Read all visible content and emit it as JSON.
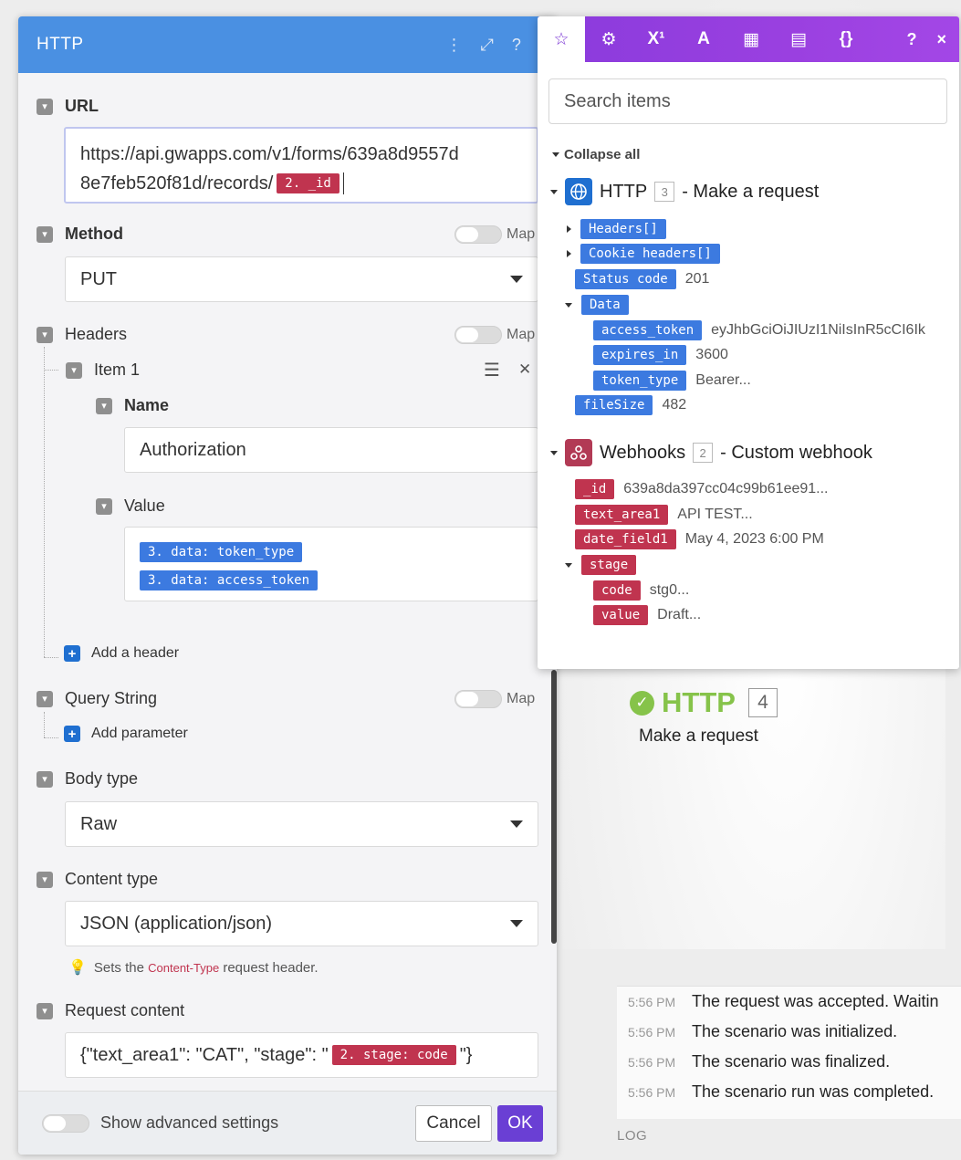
{
  "panel": {
    "title": "HTTP",
    "url_label": "URL",
    "url_text_line1": "https://api.gwapps.com/v1/forms/639a8d9557d",
    "url_text_line2": "8e7feb520f81d/records/",
    "url_pill": "2. _id",
    "method_label": "Method",
    "map_label": "Map",
    "method_value": "PUT",
    "headers_label": "Headers",
    "item_label": "Item 1",
    "name_label": "Name",
    "name_value": "Authorization",
    "value_label": "Value",
    "value_pill1": "3. data: token_type",
    "value_pill2": "3. data: access_token",
    "add_header": "Add a header",
    "query_label": "Query String",
    "add_parameter": "Add parameter",
    "body_type_label": "Body type",
    "body_type_value": "Raw",
    "content_type_label": "Content type",
    "content_type_value": "JSON (application/json)",
    "hint_prefix": "Sets the ",
    "hint_code": "Content-Type",
    "hint_suffix": " request header.",
    "request_content_label": "Request content",
    "request_prefix": "{\"text_area1\": \"CAT\", \"stage\": \"",
    "request_pill": "2. stage: code",
    "request_suffix": "\"}",
    "advanced_label": "Show advanced settings",
    "cancel_label": "Cancel",
    "ok_label": "OK"
  },
  "items_panel": {
    "tabs": [
      "☆",
      "⚙",
      "X¹",
      "A",
      "▦",
      "▤",
      "{}"
    ],
    "help": "?",
    "close": "×",
    "search_placeholder": "Search items",
    "collapse_all": "Collapse all",
    "http_module": {
      "name": "HTTP",
      "num": "3",
      "desc": "- Make a request"
    },
    "http_items": {
      "headers": "Headers[]",
      "cookie_headers": "Cookie headers[]",
      "status_code": "Status code",
      "status_code_val": "201",
      "data": "Data",
      "access_token": "access_token",
      "access_token_val": "eyJhbGciOiJIUzI1NiIsInR5cCI6Ik",
      "expires_in": "expires_in",
      "expires_in_val": "3600",
      "token_type": "token_type",
      "token_type_val": "Bearer...",
      "file_size": "fileSize",
      "file_size_val": "482"
    },
    "webhook_module": {
      "name": "Webhooks",
      "num": "2",
      "desc": "- Custom webhook"
    },
    "webhook_items": {
      "id": "_id",
      "id_val": "639a8da397cc04c99b61ee91...",
      "text_area1": "text_area1",
      "text_area1_val": "API TEST...",
      "date_field1": "date_field1",
      "date_field1_val": "May 4, 2023 6:00 PM",
      "stage": "stage",
      "code": "code",
      "code_val": "stg0...",
      "value": "value",
      "value_val": "Draft..."
    }
  },
  "canvas": {
    "node_title": "HTTP",
    "node_num": "4",
    "node_sub": "Make a request"
  },
  "log": {
    "label": "LOG",
    "entries": [
      {
        "time": "5:56 PM",
        "msg": "The request was accepted. Waitin"
      },
      {
        "time": "5:56 PM",
        "msg": "The scenario was initialized."
      },
      {
        "time": "5:56 PM",
        "msg": "The scenario was finalized."
      },
      {
        "time": "5:56 PM",
        "msg": "The scenario run was completed."
      }
    ]
  },
  "colors": {
    "header_blue": "#4a90e2",
    "items_purple": "#9a40e0",
    "pill_red": "#c0344f",
    "pill_blue": "#3c7ae0",
    "ok_purple": "#6a3fd4",
    "success_green": "#86c34a"
  },
  "icons": {
    "header": [
      "more-vertical-icon",
      "expand-icon",
      "help-icon",
      "close-icon"
    ],
    "http_module": "globe-icon",
    "webhook_module": "webhook-icon",
    "hint": "lightbulb-icon"
  }
}
